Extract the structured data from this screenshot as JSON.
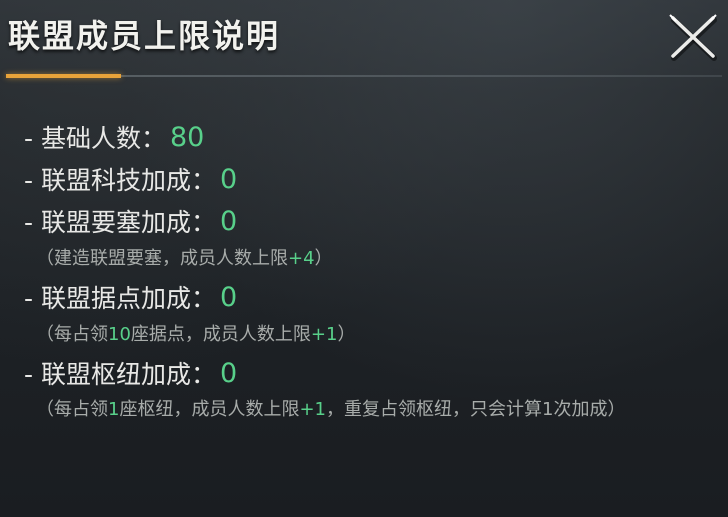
{
  "window": {
    "title": "联盟成员上限说明",
    "close_icon": "close-x-icon"
  },
  "colors": {
    "accent_orange": "#e8a33a",
    "value_green": "#58d08a",
    "text_main": "#e8e8e6",
    "text_note": "#a8acaa"
  },
  "items": {
    "base": {
      "label": "- 基础人数：",
      "value": "80"
    },
    "tech": {
      "label": "- 联盟科技加成：",
      "value": "0"
    },
    "fortress": {
      "label": "- 联盟要塞加成：",
      "value": "0",
      "note_pre": "（建造联盟要塞，成员人数上限",
      "note_hl": "+4",
      "note_post": "）"
    },
    "stronghold": {
      "label": "- 联盟据点加成：",
      "value": "0",
      "note_pre": "（每占领",
      "note_hl1": "10",
      "note_mid": "座据点，成员人数上限",
      "note_hl2": "+1",
      "note_post": "）"
    },
    "hub": {
      "label": "- 联盟枢纽加成：",
      "value": "0",
      "note_pre": "（每占领",
      "note_hl1": "1",
      "note_mid": "座枢纽，成员人数上限",
      "note_hl2": "+1",
      "note_post": "，重复占领枢纽，只会计算1次加成）"
    }
  }
}
